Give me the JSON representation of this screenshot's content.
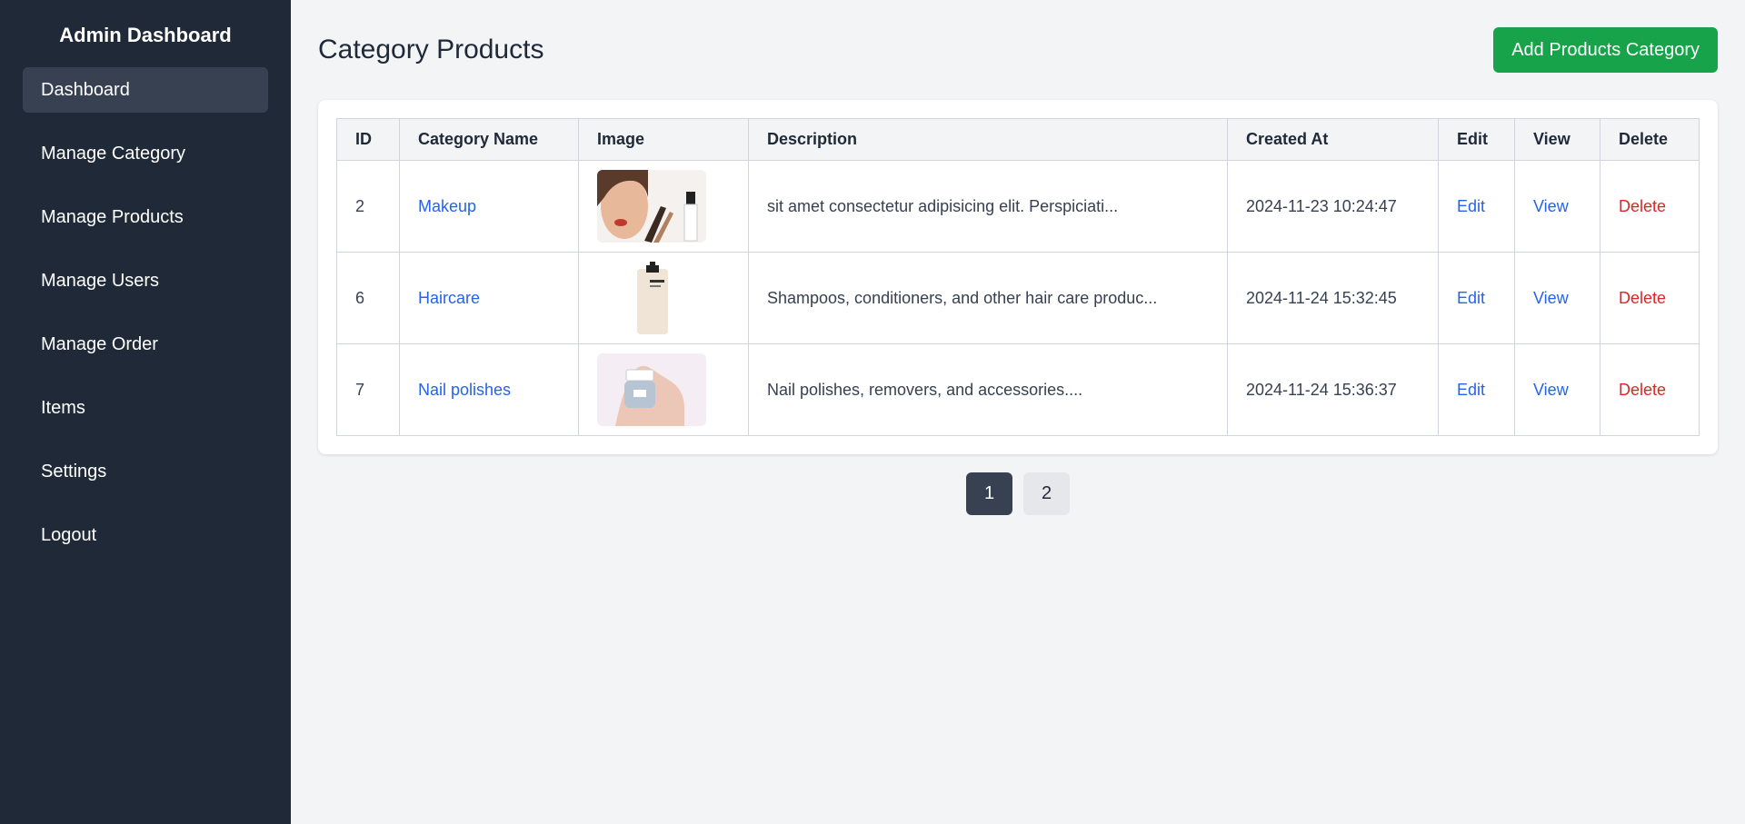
{
  "sidebar": {
    "title": "Admin Dashboard",
    "items": [
      {
        "label": "Dashboard"
      },
      {
        "label": "Manage Category"
      },
      {
        "label": "Manage Products"
      },
      {
        "label": "Manage Users"
      },
      {
        "label": "Manage Order"
      },
      {
        "label": "Items"
      },
      {
        "label": "Settings"
      },
      {
        "label": "Logout"
      }
    ],
    "active_index": 0
  },
  "header": {
    "title": "Category Products",
    "add_button_label": "Add Products Category"
  },
  "table": {
    "columns": [
      "ID",
      "Category Name",
      "Image",
      "Description",
      "Created At",
      "Edit",
      "View",
      "Delete"
    ],
    "rows": [
      {
        "id": "2",
        "name": "Makeup",
        "image_icon": "makeup-image",
        "description": "sit amet consectetur adipisicing elit. Perspiciati...",
        "created_at": "2024-11-23 10:24:47",
        "edit": "Edit",
        "view": "View",
        "delete": "Delete"
      },
      {
        "id": "6",
        "name": "Haircare",
        "image_icon": "haircare-image",
        "description": "Shampoos, conditioners, and other hair care produc...",
        "created_at": "2024-11-24 15:32:45",
        "edit": "Edit",
        "view": "View",
        "delete": "Delete"
      },
      {
        "id": "7",
        "name": "Nail polishes",
        "image_icon": "nail-polish-image",
        "description": "Nail polishes, removers, and accessories....",
        "created_at": "2024-11-24 15:36:37",
        "edit": "Edit",
        "view": "View",
        "delete": "Delete"
      }
    ]
  },
  "pagination": {
    "pages": [
      "1",
      "2"
    ],
    "current": "1"
  },
  "colors": {
    "sidebar_bg": "#1f2937",
    "active_nav": "#374151",
    "primary_button": "#16a34a",
    "link": "#2563eb",
    "delete": "#dc2626"
  }
}
